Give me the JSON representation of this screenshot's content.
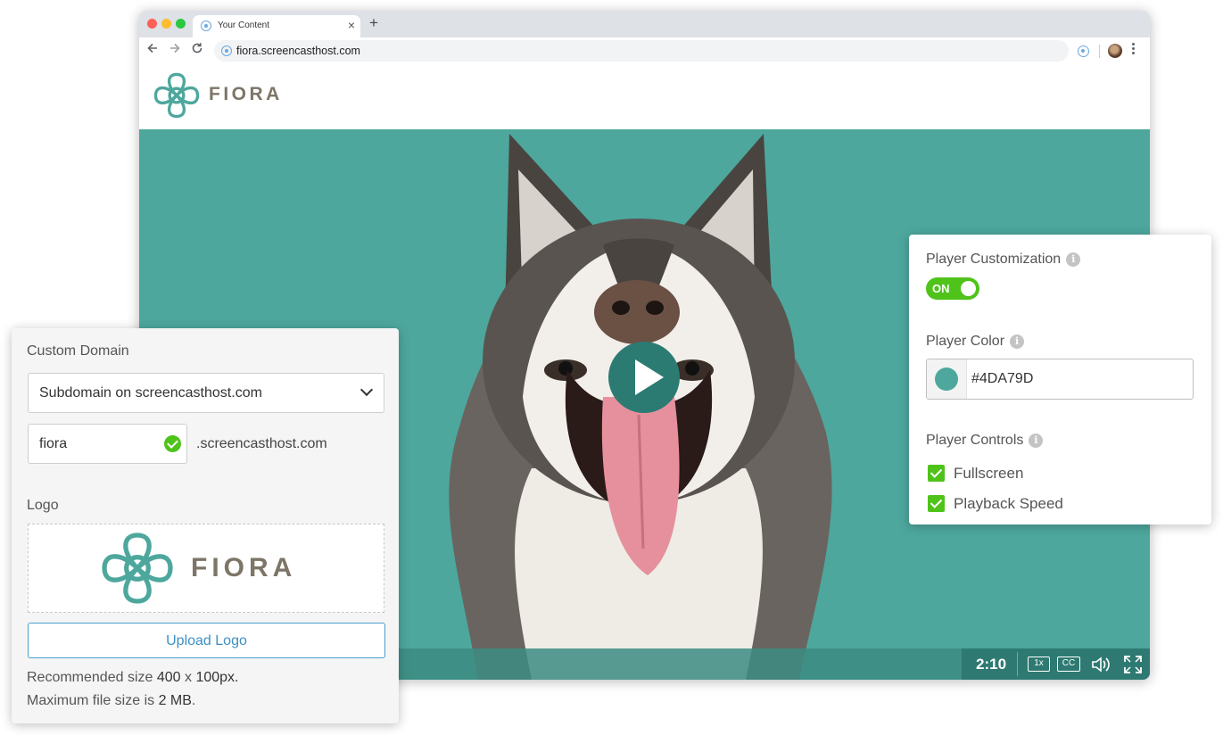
{
  "browser": {
    "tab_title": "Your Content",
    "tab_close": "×",
    "new_tab": "+",
    "url": "fiora.screencasthost.com"
  },
  "site": {
    "brand": "FIORA"
  },
  "video": {
    "time": "2:10",
    "speed": "1x",
    "captions": "CC"
  },
  "custom_domain": {
    "label": "Custom Domain",
    "select_value": "Subdomain on screencasthost.com",
    "subdomain_value": "fiora",
    "suffix": ".screencasthost.com",
    "logo_label": "Logo",
    "logo_word": "FIORA",
    "upload_button": "Upload Logo",
    "rec_prefix": "Recommended size ",
    "rec_w": "400",
    "rec_x": " x ",
    "rec_size": "100px.",
    "max_prefix": "Maximum file size is ",
    "max_size": "2 MB",
    "max_suffix": "."
  },
  "player": {
    "customization_label": "Player Customization",
    "toggle_label": "ON",
    "color_label": "Player Color",
    "color_value": "#4DA79D",
    "controls_label": "Player Controls",
    "controls": [
      {
        "label": "Fullscreen",
        "checked": true
      },
      {
        "label": "Playback Speed",
        "checked": true
      }
    ]
  },
  "colors": {
    "accent": "#4da79d",
    "toggle_on": "#4fc31a",
    "link": "#3d8fc4"
  },
  "icons": [
    "back-arrow-icon",
    "forward-arrow-icon",
    "reload-icon",
    "site-favicon-icon",
    "extension-icon",
    "profile-avatar",
    "menu-kebab-icon",
    "play-icon",
    "volume-icon",
    "fullscreen-icon",
    "chevron-down-icon",
    "check-circle-icon",
    "info-icon",
    "checkbox-checked-icon"
  ]
}
